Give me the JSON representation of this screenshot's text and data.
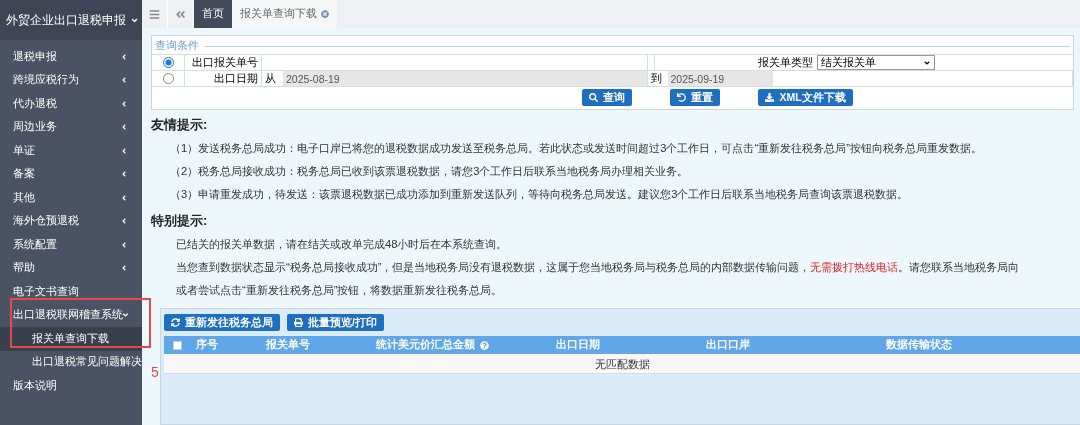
{
  "sidebar": {
    "title": "外贸企业出口退税申报",
    "items": [
      {
        "label": "退税申报",
        "kind": "menu",
        "expanded": false
      },
      {
        "label": "跨境应税行为",
        "kind": "menu",
        "expanded": false
      },
      {
        "label": "代办退税",
        "kind": "menu",
        "expanded": false
      },
      {
        "label": "周边业务",
        "kind": "menu",
        "expanded": false
      },
      {
        "label": "单证",
        "kind": "menu",
        "expanded": false
      },
      {
        "label": "备案",
        "kind": "menu",
        "expanded": false
      },
      {
        "label": "其他",
        "kind": "menu",
        "expanded": false
      },
      {
        "label": "海外仓预退税",
        "kind": "menu",
        "expanded": false
      },
      {
        "label": "系统配置",
        "kind": "menu",
        "expanded": false
      },
      {
        "label": "帮助",
        "kind": "menu",
        "expanded": false
      },
      {
        "label": "电子文书查询",
        "kind": "link"
      },
      {
        "label": "出口退税联网稽查系统",
        "kind": "menu",
        "expanded": true,
        "annotated": true,
        "children": [
          {
            "label": "报关单查询下载",
            "selected": true
          },
          {
            "label": "出口退税常见问题解决",
            "selected": false
          }
        ]
      },
      {
        "label": "版本说明",
        "kind": "link"
      }
    ]
  },
  "annotation": {
    "label": "5"
  },
  "tabs": [
    {
      "label": "首页",
      "selected": true,
      "closable": false
    },
    {
      "label": "报关单查询下载",
      "selected": false,
      "closable": true
    }
  ],
  "query": {
    "legend": "查询条件",
    "rows": [
      {
        "selected": true,
        "label": "出口报关单号",
        "kind": "text"
      },
      {
        "selected": false,
        "label": "出口日期",
        "kind": "range",
        "from_label": "从",
        "from": "2025-08-19",
        "to_label": "到",
        "to": "2025-09-19"
      }
    ],
    "type_label": "报关单类型",
    "type_value": "结关报关单",
    "buttons": [
      {
        "label": "查询"
      },
      {
        "label": "重置"
      },
      {
        "label": "XML文件下载"
      }
    ]
  },
  "notices": [
    {
      "title": "友情提示:",
      "paragraphs": [
        "（1）发送税务总局成功：电子口岸已将您的退税数据成功发送至税务总局。若此状态或发送时间超过3个工作日，可点击“重新发往税务总局”按钮向税务总局重发数据。",
        "（2）税务总局接收成功：税务总局已收到该票退税数据，请您3个工作日后联系当地税务局办理相关业务。",
        "（3）申请重发成功，待发送：该票退税数据已成功添加到重新发送队列，等待向税务总局发送。建议您3个工作日后联系当地税务局查询该票退税数据。"
      ]
    },
    {
      "title": "特别提示:",
      "paragraphs": [
        "已结关的报关单数据，请在结关或改单完成48小时后在本系统查询。",
        "当您查到数据状态显示“税务总局接收成功”，但是当地税务局没有退税数据，这属于您当地税务局与税务总局的内部数据传输问题，**无需拨打热线电话**。请您联系当地税务局向",
        "或者尝试点击“重新发往税务总局”按钮，将数据重新发往税务总局。"
      ]
    }
  ],
  "table": {
    "actions": [
      {
        "label": "重新发往税务总局"
      },
      {
        "label": "批量预览/打印"
      }
    ],
    "select_all": false,
    "columns": [
      {
        "label": "序号"
      },
      {
        "label": "报关单号"
      },
      {
        "label": "统计美元价汇总金额",
        "help": true
      },
      {
        "label": "出口日期"
      },
      {
        "label": "出口口岸"
      },
      {
        "label": "数据传输状态"
      }
    ],
    "empty": "无匹配数据"
  }
}
